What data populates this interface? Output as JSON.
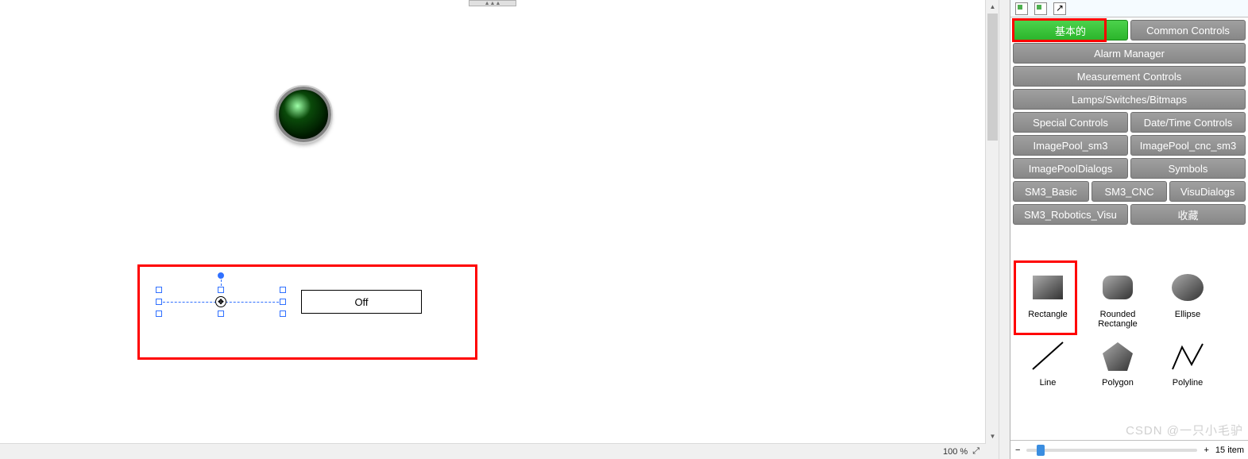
{
  "canvas": {
    "off_button": "Off",
    "zoom_label": "100 %"
  },
  "toolbox": {
    "categories": [
      {
        "key": "basic",
        "label": "基本的",
        "cls": "half active"
      },
      {
        "key": "common",
        "label": "Common Controls",
        "cls": "half"
      },
      {
        "key": "alarm",
        "label": "Alarm Manager",
        "cls": "full"
      },
      {
        "key": "measure",
        "label": "Measurement Controls",
        "cls": "full"
      },
      {
        "key": "lamps",
        "label": "Lamps/Switches/Bitmaps",
        "cls": "full"
      },
      {
        "key": "special",
        "label": "Special Controls",
        "cls": "half"
      },
      {
        "key": "datetime",
        "label": "Date/Time Controls",
        "cls": "half"
      },
      {
        "key": "ipsm3",
        "label": "ImagePool_sm3",
        "cls": "half"
      },
      {
        "key": "ipcncsm3",
        "label": "ImagePool_cnc_sm3",
        "cls": "half"
      },
      {
        "key": "ipdialogs",
        "label": "ImagePoolDialogs",
        "cls": "half"
      },
      {
        "key": "symbols",
        "label": "Symbols",
        "cls": "half"
      },
      {
        "key": "sm3basic",
        "label": "SM3_Basic",
        "cls": "third"
      },
      {
        "key": "sm3cnc",
        "label": "SM3_CNC",
        "cls": "third"
      },
      {
        "key": "visudlg",
        "label": "VisuDialogs",
        "cls": "third"
      },
      {
        "key": "sm3robot",
        "label": "SM3_Robotics_Visu",
        "cls": "half"
      },
      {
        "key": "fav",
        "label": "收藏",
        "cls": "half"
      }
    ],
    "tools": [
      {
        "key": "rectangle",
        "label": "Rectangle"
      },
      {
        "key": "roundrect",
        "label": "Rounded Rectangle"
      },
      {
        "key": "ellipse",
        "label": "Ellipse"
      },
      {
        "key": "line",
        "label": "Line"
      },
      {
        "key": "polygon",
        "label": "Polygon"
      },
      {
        "key": "polyline",
        "label": "Polyline"
      }
    ],
    "item_count_label": "15 item"
  },
  "watermark": "CSDN @一只小毛驴"
}
